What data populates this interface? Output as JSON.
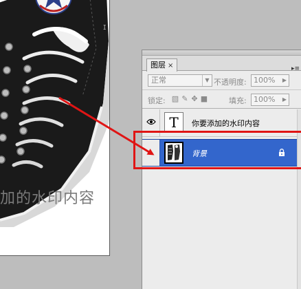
{
  "canvas": {
    "watermark_text": "加的水印内容",
    "stray_glyph": "ɪ"
  },
  "layers_panel": {
    "tab_label": "图层",
    "tab_close": "×",
    "menu_icon": "▸≡",
    "blend_mode": "正常",
    "opacity_label": "不透明度:",
    "opacity_value": "100%",
    "lock_label": "锁定:",
    "fill_label": "填充:",
    "fill_value": "100%",
    "layers": [
      {
        "name": "你要添加的水印内容",
        "thumb": "T",
        "type": "text",
        "visible": true
      },
      {
        "name": "背景",
        "type": "background",
        "visible": false,
        "selected": true,
        "locked": true
      }
    ]
  },
  "colors": {
    "selection_blue": "#3366cc",
    "annotation_red": "#e01515"
  }
}
